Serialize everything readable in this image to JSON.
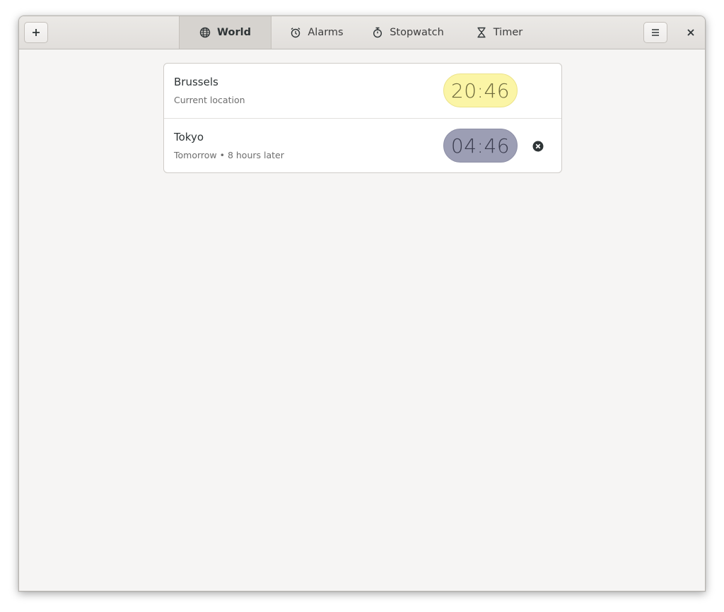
{
  "header": {
    "add_icon": "plus-icon",
    "menu_icon": "hamburger-menu-icon",
    "close_icon": "close-icon",
    "tabs": [
      {
        "label": "World",
        "icon": "globe-icon",
        "active": true
      },
      {
        "label": "Alarms",
        "icon": "alarm-clock-icon",
        "active": false
      },
      {
        "label": "Stopwatch",
        "icon": "stopwatch-icon",
        "active": false
      },
      {
        "label": "Timer",
        "icon": "hourglass-icon",
        "active": false
      }
    ]
  },
  "clocks": [
    {
      "city": "Brussels",
      "subtitle": "Current location",
      "time": "20:46",
      "period": "day",
      "removable": false
    },
    {
      "city": "Tokyo",
      "subtitle": "Tomorrow • 8 hours later",
      "time": "04:46",
      "period": "night",
      "removable": true,
      "remove_icon": "remove-circle-icon"
    }
  ],
  "colors": {
    "day_bg": "#fbf5a6",
    "night_bg": "#9c9eb4",
    "window_bg": "#f6f5f4"
  }
}
